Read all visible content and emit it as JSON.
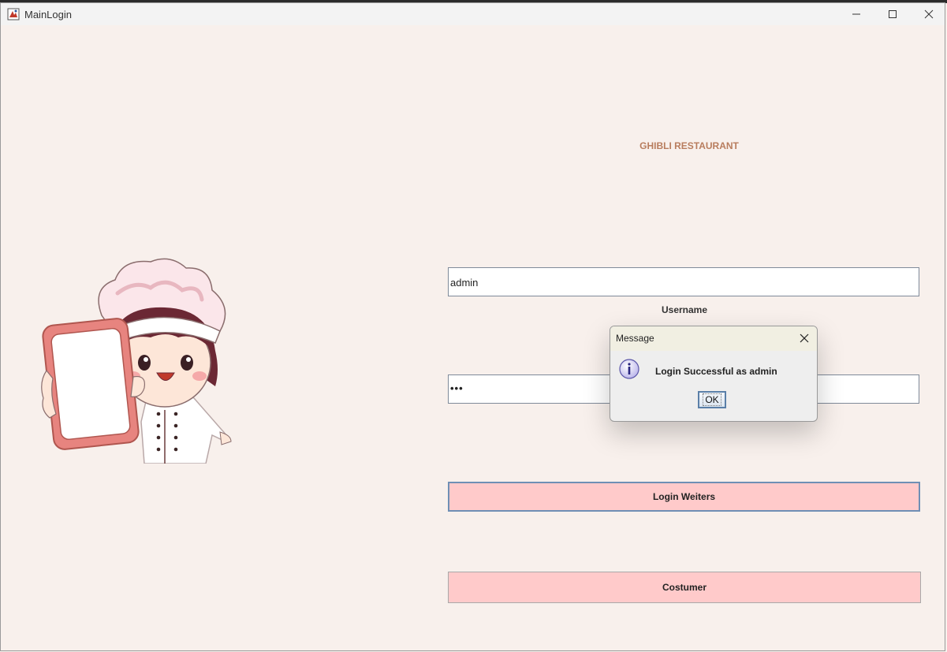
{
  "window": {
    "title": "MainLogin",
    "controls": {
      "minimize": "minimize-icon",
      "maximize": "maximize-icon",
      "close": "close-icon"
    }
  },
  "header": {
    "restaurant_name": "GHIBLI RESTAURANT"
  },
  "illustration": {
    "icon": "chef-holding-phone-illustration"
  },
  "form": {
    "username_value": "admin",
    "username_label": "Username",
    "password_value": "•••"
  },
  "buttons": {
    "login_waiters": "Login Weiters",
    "costumer": "Costumer"
  },
  "dialog": {
    "title": "Message",
    "icon": "info-icon",
    "message": "Login Successful as admin",
    "ok_label": "OK"
  },
  "colors": {
    "background": "#f8f0ec",
    "title_accent": "#b87d5e",
    "button_pink": "#ffcaca",
    "focus_border": "#6f8fb5"
  }
}
